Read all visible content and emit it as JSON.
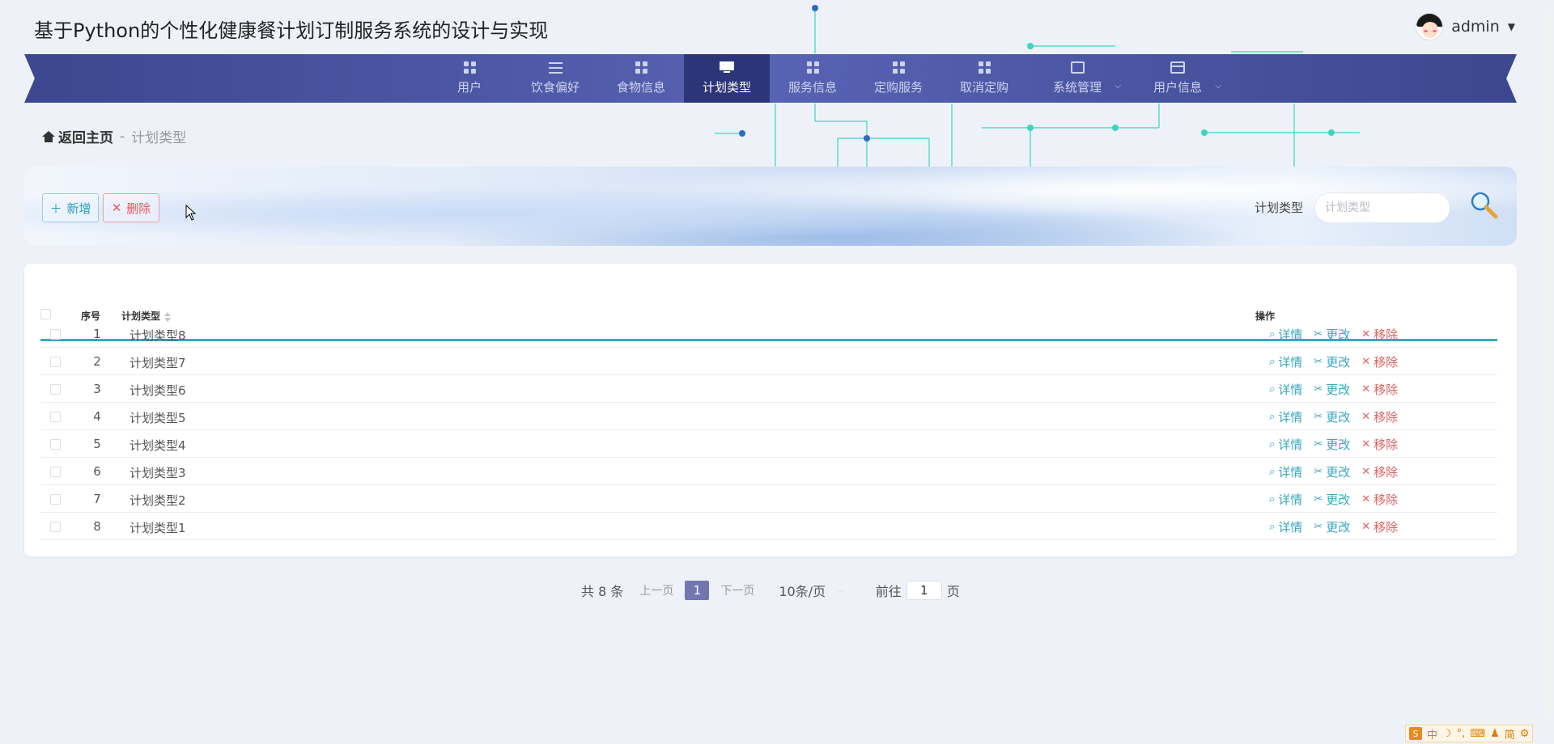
{
  "app": {
    "title": "基于Python的个性化健康餐计划订制服务系统的设计与实现",
    "user": "admin"
  },
  "nav": {
    "items": [
      {
        "label": "用户",
        "icon": "grid-icon"
      },
      {
        "label": "饮食偏好",
        "icon": "list-icon"
      },
      {
        "label": "食物信息",
        "icon": "grid-icon"
      },
      {
        "label": "计划类型",
        "icon": "monitor-icon",
        "active": true
      },
      {
        "label": "服务信息",
        "icon": "grid-icon"
      },
      {
        "label": "定购服务",
        "icon": "grid-icon"
      },
      {
        "label": "取消定购",
        "icon": "grid-icon"
      },
      {
        "label": "系统管理",
        "icon": "chart-icon",
        "dropdown": true
      },
      {
        "label": "用户信息",
        "icon": "card-icon",
        "dropdown": true
      }
    ]
  },
  "breadcrumb": {
    "home": "返回主页",
    "separator": "-",
    "current": "计划类型"
  },
  "toolbar": {
    "add_label": "新增",
    "delete_label": "删除",
    "search_label": "计划类型",
    "search_placeholder": "计划类型"
  },
  "table": {
    "headers": {
      "index": "序号",
      "type": "计划类型",
      "actions": "操作"
    },
    "actions": {
      "detail": "详情",
      "edit": "更改",
      "remove": "移除"
    },
    "rows": [
      {
        "index": "1",
        "name": "计划类型8"
      },
      {
        "index": "2",
        "name": "计划类型7"
      },
      {
        "index": "3",
        "name": "计划类型6"
      },
      {
        "index": "4",
        "name": "计划类型5"
      },
      {
        "index": "5",
        "name": "计划类型4"
      },
      {
        "index": "6",
        "name": "计划类型3"
      },
      {
        "index": "7",
        "name": "计划类型2"
      },
      {
        "index": "8",
        "name": "计划类型1"
      }
    ]
  },
  "pagination": {
    "total": "共 8 条",
    "prev": "上一页",
    "page": "1",
    "next": "下一页",
    "page_size": "10条/页",
    "goto_prefix": "前往",
    "goto_value": "1",
    "goto_suffix": "页"
  },
  "ime": {
    "items": [
      "中",
      "☽",
      "°,",
      "⌨",
      "♟",
      "简",
      "⚙"
    ]
  },
  "colors": {
    "nav_bg": "#4a55a2",
    "nav_active": "#2c3577",
    "accent": "#3aa7c0",
    "danger": "#e06060"
  }
}
